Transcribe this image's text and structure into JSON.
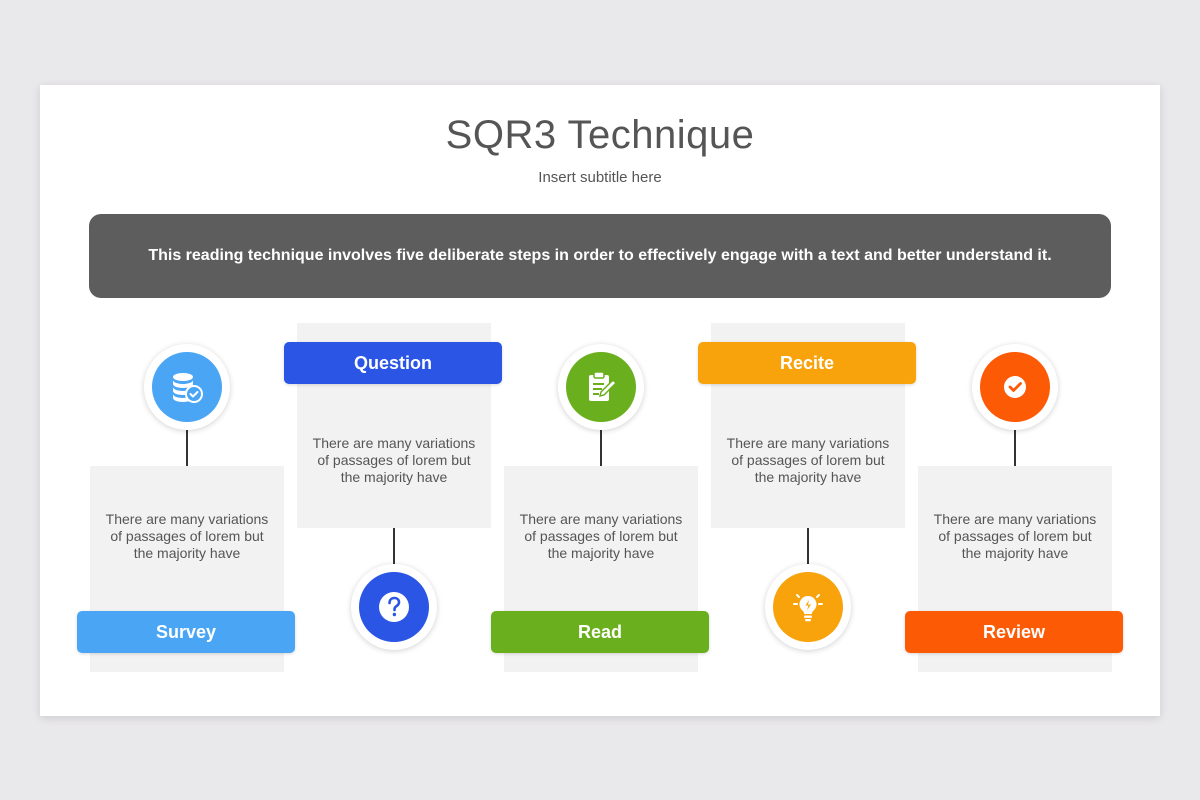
{
  "title": "SQR3 Technique",
  "subtitle": "Insert subtitle here",
  "banner": "This reading technique involves five deliberate steps in order to effectively engage with a text and better understand it.",
  "steps": [
    {
      "label": "Survey",
      "text": "There are many variations of passages of lorem but the majority have",
      "color": "#4aa6f5",
      "icon": "database-check-icon"
    },
    {
      "label": "Question",
      "text": "There are many variations of passages of lorem but the majority have",
      "color": "#2a55e5",
      "icon": "question-icon"
    },
    {
      "label": "Read",
      "text": "There are many variations of passages of lorem but the majority have",
      "color": "#6aaf1d",
      "icon": "document-pencil-icon"
    },
    {
      "label": "Recite",
      "text": "There are many variations of passages of lorem but the majority have",
      "color": "#f8a30c",
      "icon": "lightbulb-icon"
    },
    {
      "label": "Review",
      "text": "There are many variations of passages of lorem but the majority have",
      "color": "#fd5a06",
      "icon": "check-badge-icon"
    }
  ]
}
